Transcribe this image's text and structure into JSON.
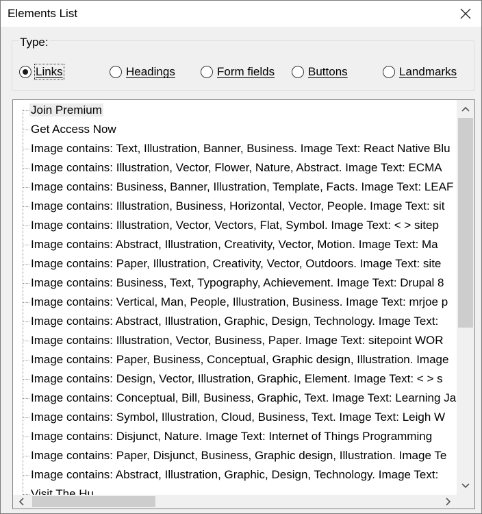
{
  "window": {
    "title": "Elements List"
  },
  "type_group": {
    "label": "Type:",
    "options": [
      {
        "label": "Links",
        "checked": true
      },
      {
        "label": "Headings",
        "checked": false
      },
      {
        "label": "Form fields",
        "checked": false
      },
      {
        "label": "Buttons",
        "checked": false
      },
      {
        "label": "Landmarks",
        "checked": false
      }
    ]
  },
  "list": {
    "items": [
      "Join Premium",
      "Get Access Now",
      "Image contains: Text, Illustration, Banner, Business. Image Text: React Native Blu",
      "Image contains: Illustration, Vector, Flower, Nature, Abstract. Image Text: ECMA",
      "Image contains: Business, Banner, Illustration, Template, Facts. Image Text: LEAF",
      "Image contains: Illustration, Business, Horizontal, Vector, People. Image Text: sit",
      "Image contains: Illustration, Vector, Vectors, Flat, Symbol. Image Text: < > sitep",
      "Image contains: Abstract, Illustration, Creativity, Vector, Motion. Image Text: Ma",
      "Image contains: Paper, Illustration, Creativity, Vector, Outdoors. Image Text: site",
      "Image contains: Business, Text, Typography, Achievement. Image Text: Drupal 8",
      "Image contains: Vertical, Man, People, Illustration, Business. Image Text: mrjoe p",
      "Image contains: Abstract, Illustration, Graphic, Design, Technology. Image Text:",
      "Image contains: Illustration, Vector, Business, Paper. Image Text: sitepoint WOR",
      "Image contains: Paper, Business, Conceptual, Graphic design, Illustration. Image",
      "Image contains: Design, Vector, Illustration, Graphic, Element. Image Text: < > s",
      "Image contains: Conceptual, Bill, Business, Graphic, Text. Image Text: Learning Ja",
      "Image contains: Symbol, Illustration, Cloud, Business, Text. Image Text: Leigh W",
      "Image contains: Disjunct, Nature. Image Text: Internet of Things Programming",
      "Image contains: Paper, Disjunct, Business, Graphic design, Illustration. Image Te",
      "Image contains: Abstract, Illustration, Graphic, Design, Technology. Image Text:",
      "Visit The Hu"
    ],
    "selected_index": 0
  },
  "icons": {
    "close": "close-icon",
    "scroll_up": "chevron-up-icon",
    "scroll_down": "chevron-down-icon",
    "scroll_left": "chevron-left-icon",
    "scroll_right": "chevron-right-icon"
  },
  "colors": {
    "dialog_bg": "#f0f0f0",
    "selected_bg": "#ececec",
    "scroll_thumb": "#cdcdcd"
  }
}
